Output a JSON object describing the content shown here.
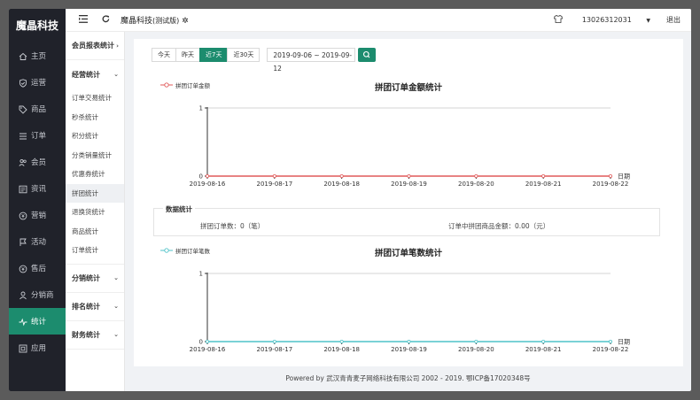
{
  "sidebar": {
    "brand": "魔晶科技",
    "items": [
      {
        "label": "主页",
        "icon": "home-icon"
      },
      {
        "label": "运营",
        "icon": "shield-check-icon"
      },
      {
        "label": "商品",
        "icon": "tag-icon"
      },
      {
        "label": "订单",
        "icon": "list-icon"
      },
      {
        "label": "会员",
        "icon": "users-icon"
      },
      {
        "label": "资讯",
        "icon": "news-icon"
      },
      {
        "label": "营销",
        "icon": "coin-icon"
      },
      {
        "label": "活动",
        "icon": "flag-icon"
      },
      {
        "label": "售后",
        "icon": "coin-icon"
      },
      {
        "label": "分销商",
        "icon": "person-icon"
      },
      {
        "label": "统计",
        "icon": "pulse-icon",
        "active": true
      },
      {
        "label": "应用",
        "icon": "app-icon"
      }
    ],
    "accent": "#1c8c6e"
  },
  "subnav": {
    "group_member": "会员报表统计",
    "group_operation": "经营统计",
    "items": [
      "订单交易统计",
      "秒杀统计",
      "积分统计",
      "分类销量统计",
      "优惠券统计",
      "拼团统计",
      "退换货统计",
      "商品统计",
      "订单统计"
    ],
    "active_index": 5,
    "group_distribution": "分销统计",
    "group_rank": "排名统计",
    "group_finance": "财务统计"
  },
  "header": {
    "title": "魔晶科技",
    "title_suffix": "(测试版)",
    "phone": "13026312031",
    "logout": "退出"
  },
  "toolbar": {
    "buttons": [
      "今天",
      "昨天",
      "近7天",
      "近30天"
    ],
    "active_index": 2,
    "date_range": "2019-09-06 ~ 2019-09-12"
  },
  "stats": {
    "title": "数据统计",
    "left": "拼团订单数：0（笔）",
    "right": "订单中拼团商品金额：0.00（元）"
  },
  "chart_data": [
    {
      "type": "line",
      "title": "拼团订单金额统计",
      "series": [
        {
          "name": "拼团订单金额",
          "values": [
            0,
            0,
            0,
            0,
            0,
            0,
            0
          ],
          "color": "#e05a5a"
        }
      ],
      "x": [
        "2019-08-16",
        "2019-08-17",
        "2019-08-18",
        "2019-08-19",
        "2019-08-20",
        "2019-08-21",
        "2019-08-22"
      ],
      "xlabel": "日期",
      "ylabel": "",
      "ylim": [
        0,
        1
      ],
      "yticks": [
        "0",
        "1"
      ]
    },
    {
      "type": "line",
      "title": "拼团订单笔数统计",
      "series": [
        {
          "name": "拼团订单笔数",
          "values": [
            0,
            0,
            0,
            0,
            0,
            0,
            0
          ],
          "color": "#4fc3c8"
        }
      ],
      "x": [
        "2019-08-16",
        "2019-08-17",
        "2019-08-18",
        "2019-08-19",
        "2019-08-20",
        "2019-08-21",
        "2019-08-22"
      ],
      "xlabel": "日期",
      "ylabel": "",
      "ylim": [
        0,
        1
      ],
      "yticks": [
        "0",
        "1"
      ]
    }
  ],
  "footer": "Powered by 武汉青青麦子网络科技有限公司 2002 - 2019. 鄂ICP备17020348号"
}
